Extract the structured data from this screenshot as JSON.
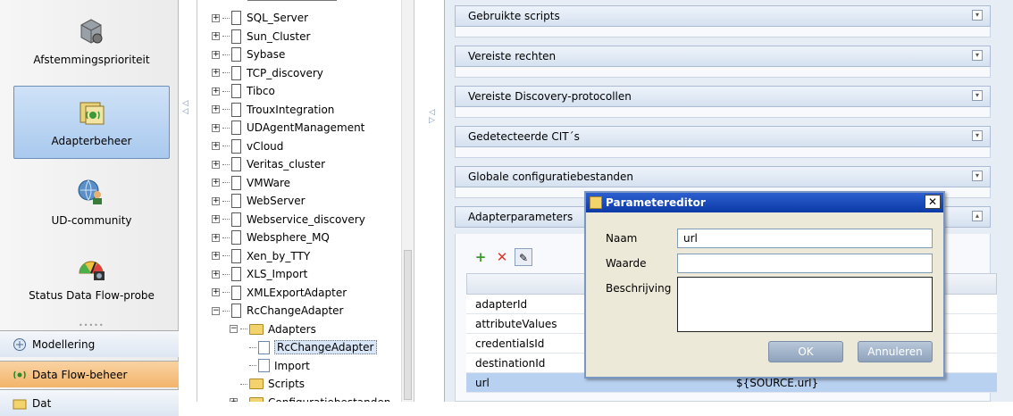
{
  "leftnav": {
    "items": [
      {
        "label": "Afstemmingsprioriteit",
        "icon": "gear-box-icon"
      },
      {
        "label": "Adapterbeheer",
        "icon": "adapter-icon"
      },
      {
        "label": "UD-community",
        "icon": "community-globe-icon"
      },
      {
        "label": "Status Data Flow-probe",
        "icon": "probe-gauge-icon"
      }
    ],
    "bars": [
      {
        "label": "Modellering",
        "icon": "modeling-icon"
      },
      {
        "label": "Data Flow-beheer",
        "icon": "data-flow-icon"
      },
      {
        "label": "Dat",
        "icon": "data-folder-icon"
      }
    ]
  },
  "tree": {
    "nodes": [
      "SQL_Server",
      "Sun_Cluster",
      "Sybase",
      "TCP_discovery",
      "Tibco",
      "TrouxIntegration",
      "UDAgentManagement",
      "vCloud",
      "Veritas_cluster",
      "VMWare",
      "WebServer",
      "Webservice_discovery",
      "Websphere_MQ",
      "Xen_by_TTY",
      "XLS_Import",
      "XMLExportAdapter",
      "RcChangeAdapter"
    ],
    "children": {
      "adapters": "Adapters",
      "selected_adapter": "RcChangeAdapter",
      "import": "Import",
      "scripts": "Scripts",
      "config": "Configuratiebestanden"
    }
  },
  "sections": [
    "Gebruikte scripts",
    "Vereiste rechten",
    "Vereiste Discovery-protocollen",
    "Gedetecteerde CIT´s",
    "Globale configuratiebestanden",
    "Adapterparameters"
  ],
  "params": {
    "rows": [
      {
        "name": "adapterId",
        "value": ""
      },
      {
        "name": "attributeValues",
        "value": ""
      },
      {
        "name": "credentialsId",
        "value": ""
      },
      {
        "name": "destinationId",
        "value": ""
      },
      {
        "name": "url",
        "value": "${SOURCE.url}"
      }
    ]
  },
  "dialog": {
    "title": "Parametereditor",
    "close": "✕",
    "name_label": "Naam",
    "name_value": "url",
    "value_label": "Waarde",
    "value_value": "",
    "desc_label": "Beschrijving",
    "ok": "OK",
    "cancel": "Annuleren"
  }
}
